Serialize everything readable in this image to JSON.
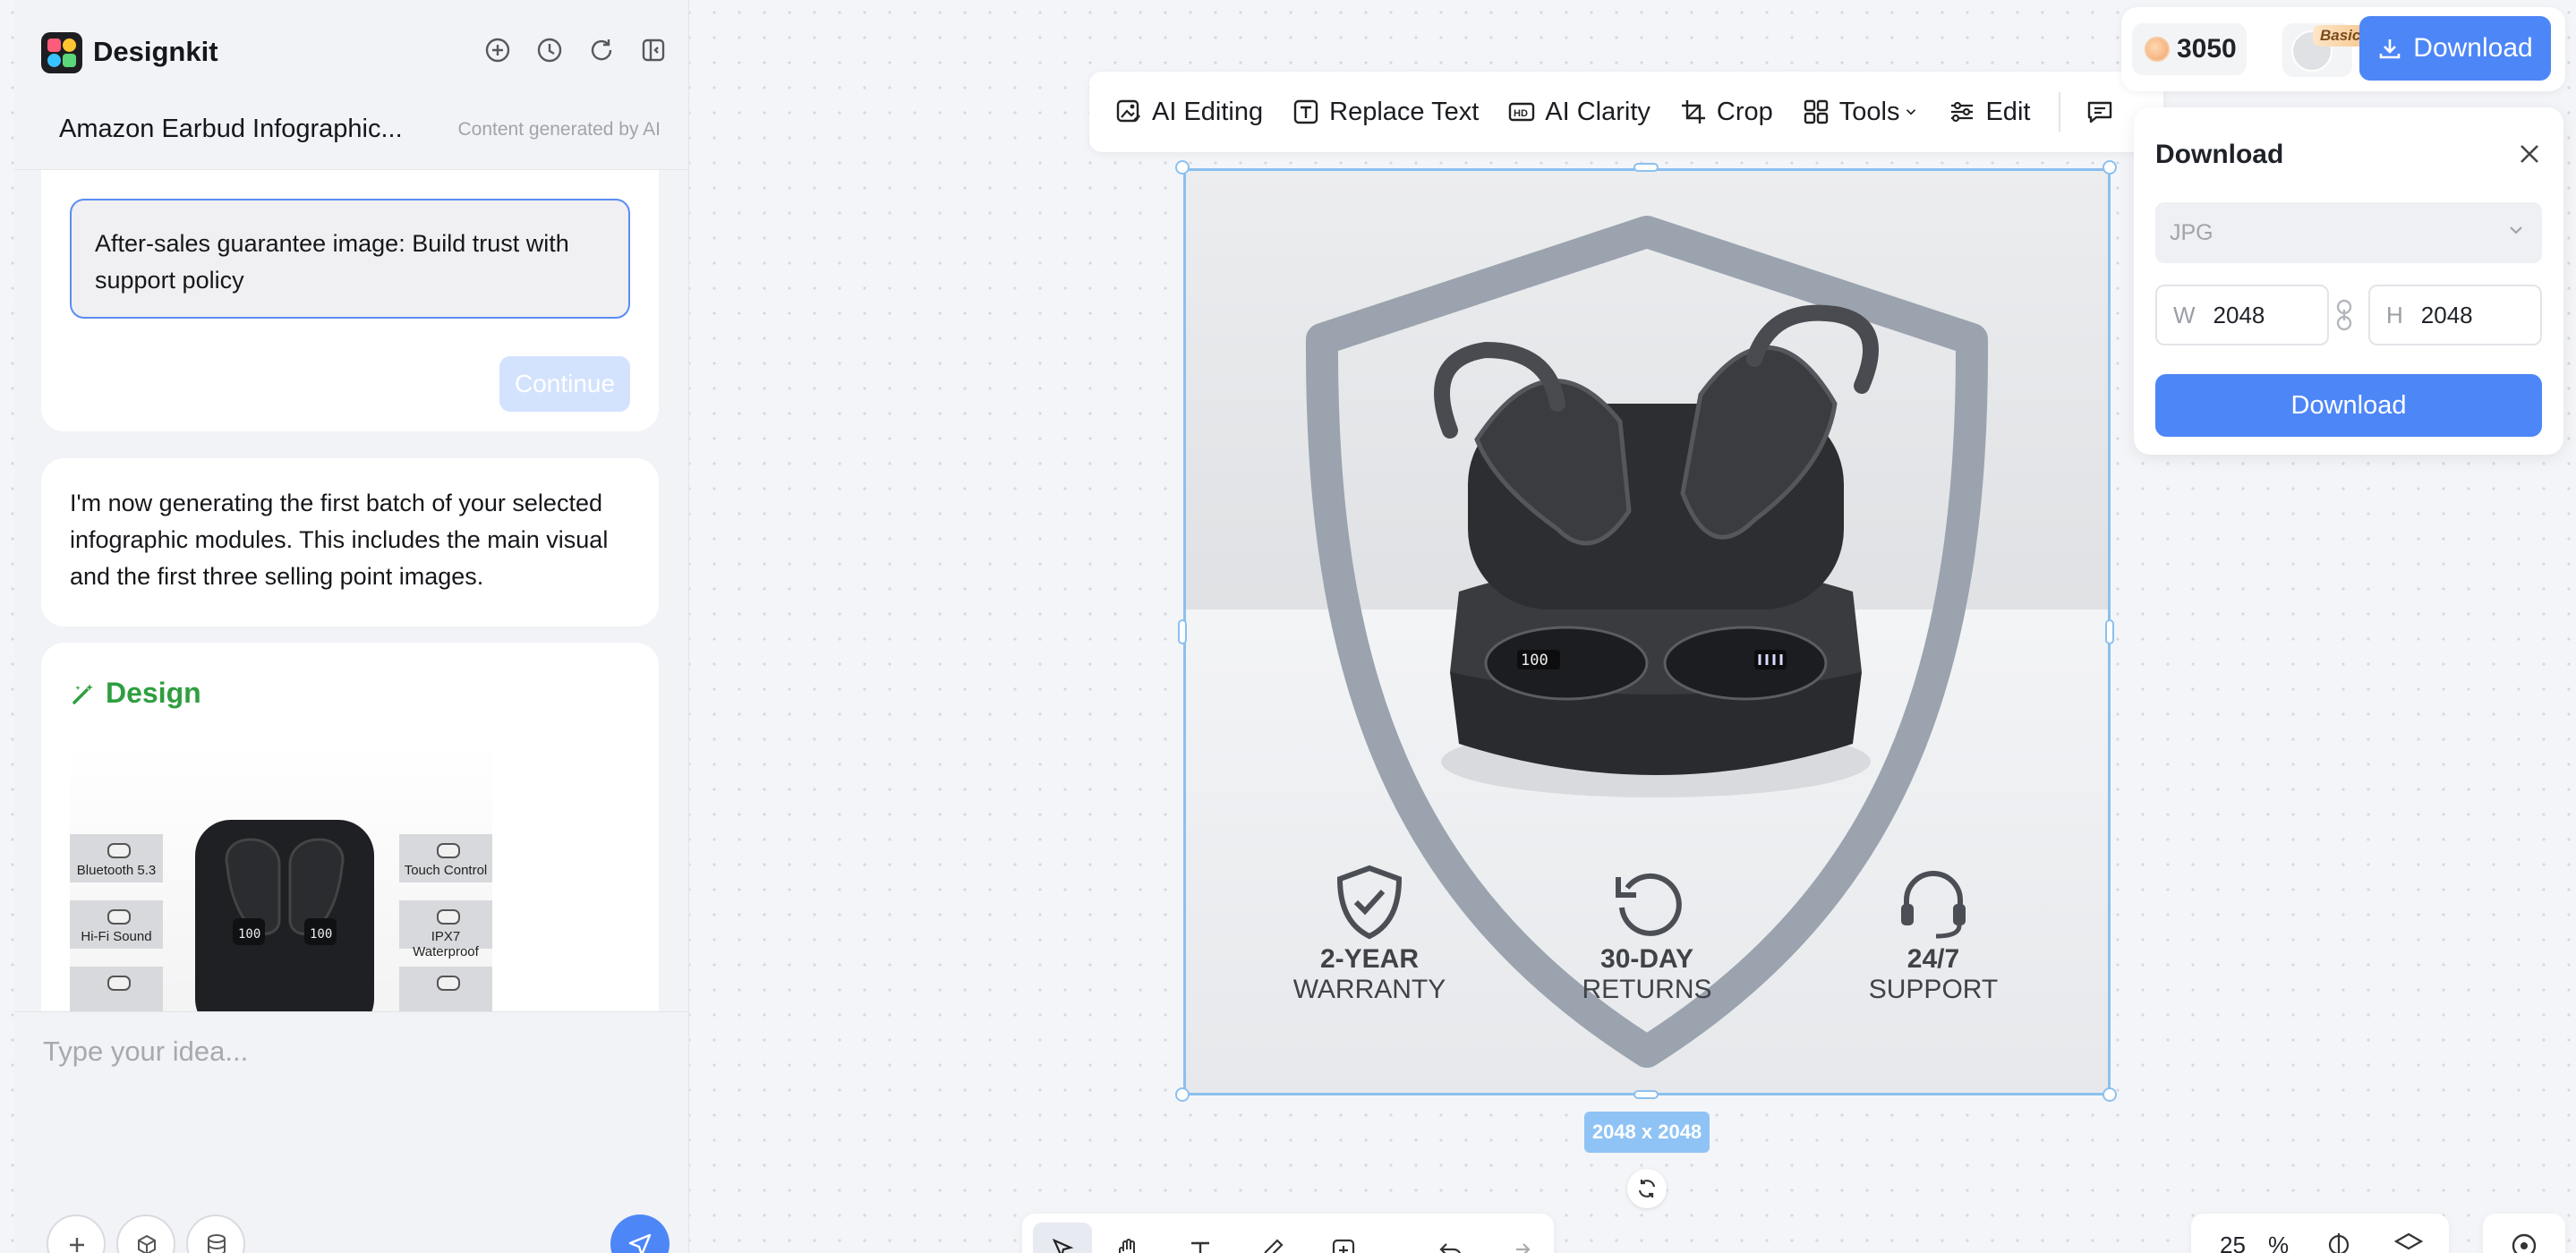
{
  "app": {
    "name": "Designkit"
  },
  "project": {
    "title": "Amazon Earbud Infographic...",
    "subtitle": "Content generated by AI"
  },
  "chat": {
    "option_text": "After-sales guarantee image: Build trust with support policy",
    "continue_label": "Continue",
    "message": "I'm now generating the first batch of your selected infographic modules. This includes the main visual and the first three selling point images.",
    "design_label": "Design",
    "thumb_chips": [
      "Bluetooth 5.3",
      "Touch Control",
      "Hi-Fi Sound",
      "IPX7 Waterproof"
    ],
    "input_placeholder": "Type your idea..."
  },
  "toolbar": {
    "items": [
      "AI Editing",
      "Replace Text",
      "AI Clarity",
      "Crop",
      "Tools",
      "Edit"
    ]
  },
  "canvas": {
    "badges": [
      {
        "line1": "2-YEAR",
        "line2": "WARRANTY"
      },
      {
        "line1": "30-DAY",
        "line2": "RETURNS"
      },
      {
        "line1": "24/7",
        "line2": "SUPPORT"
      }
    ],
    "case_display": "100",
    "size_label": "2048 x 2048"
  },
  "account": {
    "credits": "3050",
    "plan": "Basic",
    "download_label": "Download"
  },
  "download_panel": {
    "title": "Download",
    "format": "JPG",
    "width_key": "W",
    "width": "2048",
    "height_key": "H",
    "height": "2048",
    "button": "Download"
  },
  "zoom": {
    "value": "25",
    "unit": "%"
  },
  "colors": {
    "accent": "#4d86f7",
    "design_green": "#2f9e3f",
    "selection": "#8cc0ef"
  }
}
